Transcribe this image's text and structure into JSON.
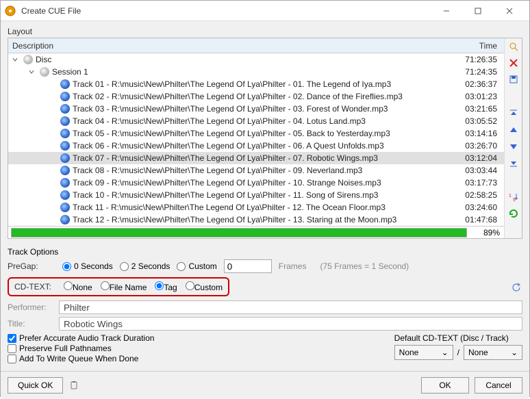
{
  "window": {
    "title": "Create CUE File"
  },
  "layout_label": "Layout",
  "headers": {
    "desc": "Description",
    "time": "Time"
  },
  "disc": {
    "label": "Disc",
    "time": "71:26:35"
  },
  "session": {
    "label": "Session 1",
    "time": "71:24:35"
  },
  "tracks": [
    {
      "label": "Track 01 - R:\\music\\New\\Philter\\The Legend Of Lya\\Philter - 01. The Legend of Iya.mp3",
      "time": "02:36:37"
    },
    {
      "label": "Track 02 - R:\\music\\New\\Philter\\The Legend Of Lya\\Philter - 02. Dance of the Fireflies.mp3",
      "time": "03:01:23"
    },
    {
      "label": "Track 03 - R:\\music\\New\\Philter\\The Legend Of Lya\\Philter - 03. Forest of Wonder.mp3",
      "time": "03:21:65"
    },
    {
      "label": "Track 04 - R:\\music\\New\\Philter\\The Legend Of Lya\\Philter - 04. Lotus Land.mp3",
      "time": "03:05:52"
    },
    {
      "label": "Track 05 - R:\\music\\New\\Philter\\The Legend Of Lya\\Philter - 05. Back to Yesterday.mp3",
      "time": "03:14:16"
    },
    {
      "label": "Track 06 - R:\\music\\New\\Philter\\The Legend Of Lya\\Philter - 06. A Quest Unfolds.mp3",
      "time": "03:26:70"
    },
    {
      "label": "Track 07 - R:\\music\\New\\Philter\\The Legend Of Lya\\Philter - 07. Robotic Wings.mp3",
      "time": "03:12:04"
    },
    {
      "label": "Track 08 - R:\\music\\New\\Philter\\The Legend Of Lya\\Philter - 09. Neverland.mp3",
      "time": "03:03:44"
    },
    {
      "label": "Track 09 - R:\\music\\New\\Philter\\The Legend Of Lya\\Philter - 10. Strange Noises.mp3",
      "time": "03:17:73"
    },
    {
      "label": "Track 10 - R:\\music\\New\\Philter\\The Legend Of Lya\\Philter - 11. Song of Sirens.mp3",
      "time": "02:58:25"
    },
    {
      "label": "Track 11 - R:\\music\\New\\Philter\\The Legend Of Lya\\Philter - 12. The Ocean Floor.mp3",
      "time": "03:24:60"
    },
    {
      "label": "Track 12 - R:\\music\\New\\Philter\\The Legend Of Lya\\Philter - 13. Staring at the Moon.mp3",
      "time": "01:47:68"
    }
  ],
  "selected_track_index": 6,
  "progress": {
    "percent": "89%"
  },
  "track_options_title": "Track Options",
  "pregap": {
    "label": "PreGap:",
    "options": {
      "zero": "0 Seconds",
      "two": "2 Seconds",
      "custom": "Custom"
    },
    "custom_value": "0",
    "frames_label": "Frames",
    "hint": "(75 Frames = 1 Second)"
  },
  "cdtext": {
    "label": "CD-TEXT:",
    "options": {
      "none": "None",
      "filename": "File Name",
      "tag": "Tag",
      "custom": "Custom"
    }
  },
  "fields": {
    "performer_label": "Performer:",
    "performer_value": "Philter",
    "title_label": "Title:",
    "title_value": "Robotic Wings"
  },
  "checks": {
    "accurate": "Prefer Accurate Audio Track Duration",
    "preserve": "Preserve Full Pathnames",
    "addqueue": "Add To Write Queue When Done"
  },
  "default_cd": {
    "title": "Default CD-TEXT (Disc / Track)",
    "disc": "None",
    "track": "None",
    "sep": "/"
  },
  "buttons": {
    "quick_ok": "Quick OK",
    "ok": "OK",
    "cancel": "Cancel"
  }
}
